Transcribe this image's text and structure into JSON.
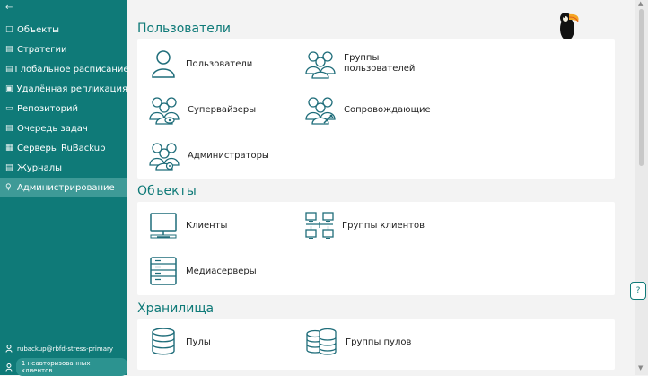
{
  "sidebar": {
    "collapse_icon": "←",
    "items": [
      {
        "icon": "□",
        "label": "Объекты",
        "active": false
      },
      {
        "icon": "▤",
        "label": "Стратегии",
        "active": false
      },
      {
        "icon": "▤",
        "label": "Глобальное расписание",
        "active": false
      },
      {
        "icon": "▣",
        "label": "Удалённая репликация",
        "active": false
      },
      {
        "icon": "▭",
        "label": "Репозиторий",
        "active": false
      },
      {
        "icon": "▤",
        "label": "Очередь задач",
        "active": false
      },
      {
        "icon": "▦",
        "label": "Серверы RuBackup",
        "active": false
      },
      {
        "icon": "▤",
        "label": "Журналы",
        "active": false
      },
      {
        "icon": "♀",
        "label": "Администрирование",
        "active": true
      }
    ],
    "user": "rubackup@rbfd-stress-primary",
    "unauthorized": "1 неавторизованных клиентов"
  },
  "sections": {
    "users": {
      "title": "Пользователи",
      "tiles": [
        {
          "label": "Пользователи",
          "icon": "user-icon"
        },
        {
          "label": "Группы\nпользователей",
          "icon": "user-group-icon"
        },
        {
          "label": "Супервайзеры",
          "icon": "supervisors-icon"
        },
        {
          "label": "Сопровождающие",
          "icon": "maintainers-icon"
        },
        {
          "label": "Администраторы",
          "icon": "administrators-icon"
        }
      ]
    },
    "objects": {
      "title": "Объекты",
      "tiles": [
        {
          "label": "Клиенты",
          "icon": "monitor-icon"
        },
        {
          "label": "Группы клиентов",
          "icon": "client-groups-icon"
        },
        {
          "label": "Медиасерверы",
          "icon": "media-server-icon"
        }
      ]
    },
    "storage": {
      "title": "Хранилища",
      "tiles": [
        {
          "label": "Пулы",
          "icon": "database-icon"
        },
        {
          "label": "Группы пулов",
          "icon": "database-group-icon"
        }
      ]
    }
  },
  "help_icon": "?",
  "colors": {
    "primary": "#0f7a78",
    "active": "#3e9a97",
    "background": "#f3f3f3"
  }
}
